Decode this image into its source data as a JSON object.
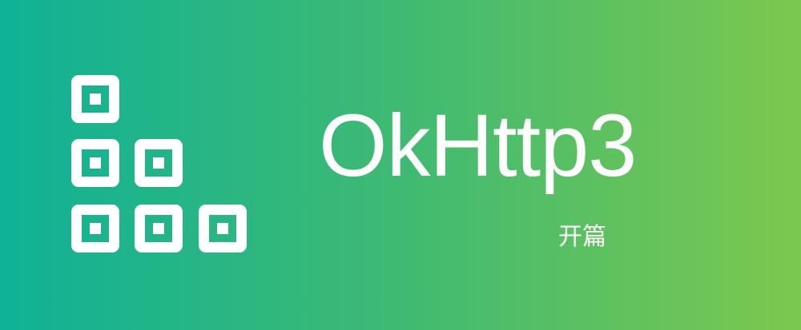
{
  "banner": {
    "title": "OkHttp3",
    "subtitle": "开篇",
    "logo_icon": "stacked-square-blocks-icon"
  },
  "colors": {
    "gradient_start": "#0fb197",
    "gradient_mid": "#3fba72",
    "gradient_end": "#7cc84f",
    "foreground": "#ffffff"
  }
}
